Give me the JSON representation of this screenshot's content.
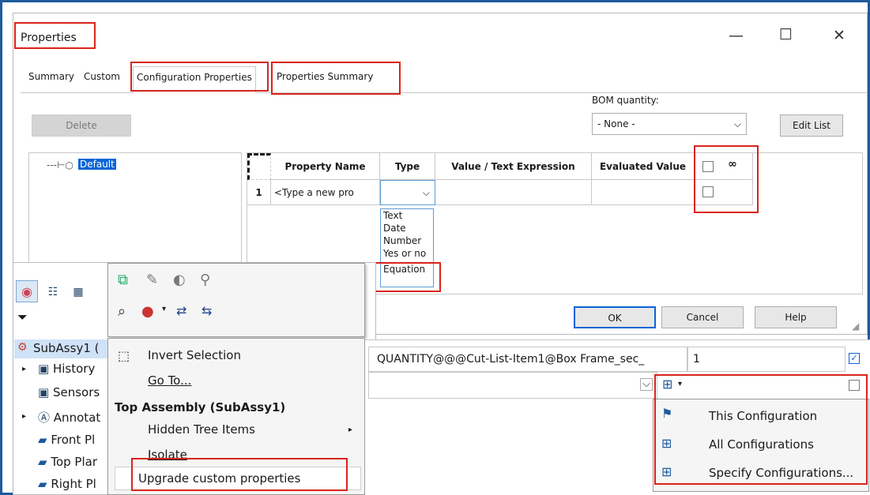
{
  "window": {
    "title": "Properties",
    "tabs": [
      "Summary",
      "Custom",
      "Configuration Properties",
      "Properties Summary"
    ],
    "bom_quantity_label": "BOM quantity:",
    "bom_quantity_value": "- None -",
    "delete_label": "Delete",
    "edit_list_label": "Edit List",
    "tree_item": "Default",
    "ok_label": "OK",
    "cancel_label": "Cancel",
    "help_label": "Help"
  },
  "grid": {
    "headers": [
      "Property Name",
      "Type",
      "Value / Text Expression",
      "Evaluated Value"
    ],
    "row_number": "1",
    "new_row_placeholder": "<Type a new pro"
  },
  "type_dropdown": [
    "Text",
    "Date",
    "Number",
    "Yes or no",
    "Equation"
  ],
  "feature_tree": {
    "root": "SubAssy1 (",
    "items": [
      "History",
      "Sensors",
      "Annotat",
      "Front Pl",
      "Top Plar",
      "Right Pl"
    ]
  },
  "context_menu": {
    "invert_selection": "Invert Selection",
    "go_to": "Go To...",
    "section_title": "Top Assembly (SubAssy1)",
    "hidden_tree_items": "Hidden Tree Items",
    "isolate": "Isolate",
    "upgrade": "Upgrade custom properties"
  },
  "right_panel": {
    "row_expression": "QUANTITY@@@Cut-List-Item1@Box Frame_sec_",
    "row_value": "1"
  },
  "config_menu": [
    "This Configuration",
    "All Configurations",
    "Specify Configurations..."
  ],
  "colors": {
    "highlight_red": "#d9241c",
    "frame_blue": "#1d5a9c",
    "selection_blue": "#0a64d6"
  }
}
